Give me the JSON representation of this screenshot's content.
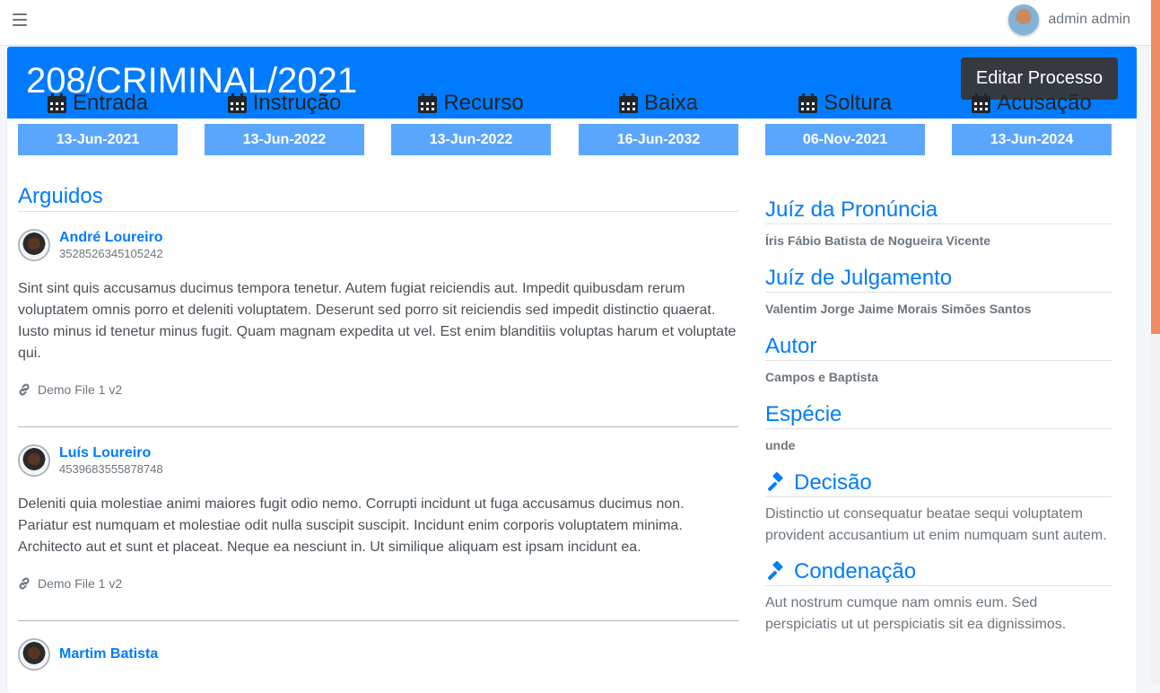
{
  "topbar": {
    "menu_icon": "hamburger-icon",
    "user_name": "admin admin"
  },
  "header": {
    "case_number": "208/CRIMINAL/2021",
    "edit_label": "Editar Processo"
  },
  "dates": [
    {
      "label": "Entrada",
      "value": "13-Jun-2021",
      "icon": "calendar-icon"
    },
    {
      "label": "Instrução",
      "value": "13-Jun-2022",
      "icon": "calendar-icon"
    },
    {
      "label": "Recurso",
      "value": "13-Jun-2022",
      "icon": "calendar-icon"
    },
    {
      "label": "Baixa",
      "value": "16-Jun-2032",
      "icon": "calendar-icon"
    },
    {
      "label": "Soltura",
      "value": "06-Nov-2021",
      "icon": "calendar-icon"
    },
    {
      "label": "Acusação",
      "value": "13-Jun-2024",
      "icon": "calendar-icon"
    }
  ],
  "arguidos": {
    "title": "Arguidos",
    "items": [
      {
        "name": "André Loureiro",
        "id_number": "3528526345105242",
        "text": "Sint sint quis accusamus ducimus tempora tenetur. Autem fugiat reiciendis aut. Impedit quibusdam rerum voluptatem omnis porro et deleniti voluptatem. Deserunt sed porro sit reiciendis sed impedit distinctio quaerat. Iusto minus id tenetur minus fugit. Quam magnam expedita ut vel. Est enim blanditiis voluptas harum et voluptate qui.",
        "attachment": "Demo File 1 v2"
      },
      {
        "name": "Luís Loureiro",
        "id_number": "4539683555878748",
        "text": "Deleniti quia molestiae animi maiores fugit odio nemo. Corrupti incidunt ut fuga accusamus ducimus non. Pariatur est numquam et molestiae odit nulla suscipit suscipit. Incidunt enim corporis voluptatem minima. Architecto aut et sunt et placeat. Neque ea nesciunt in. Ut similique aliquam est ipsam incidunt ea.",
        "attachment": "Demo File 1 v2"
      },
      {
        "name": "Martim Batista",
        "id_number": "",
        "text": "",
        "attachment": ""
      }
    ]
  },
  "sidebar": {
    "juiz_pronuncia": {
      "title": "Juíz da Pronúncia",
      "value": "Íris Fábio Batista de Nogueira Vicente"
    },
    "juiz_julgamento": {
      "title": "Juíz de Julgamento",
      "value": "Valentim Jorge Jaime Morais Simões Santos"
    },
    "autor": {
      "title": "Autor",
      "value": "Campos e Baptista"
    },
    "especie": {
      "title": "Espécie",
      "value": "unde"
    },
    "decisao": {
      "title": "Decisão",
      "icon": "gavel-icon",
      "text": "Distinctio ut consequatur beatae sequi voluptatem provident accusantium ut enim numquam sunt autem."
    },
    "condenacao": {
      "title": "Condenação",
      "icon": "gavel-icon",
      "text": "Aut nostrum cumque nam omnis eum. Sed perspiciatis ut ut perspiciatis sit ea dignissimos."
    }
  },
  "colors": {
    "primary": "#007bff",
    "date_badge": "#5aa6ff",
    "dark_button": "#343a40",
    "scroll_accent": "#f08c63"
  }
}
